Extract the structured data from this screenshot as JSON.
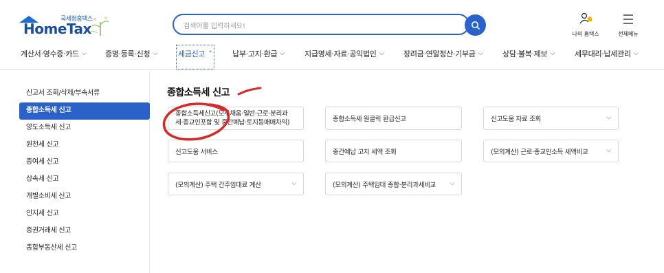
{
  "header": {
    "logo_small": "국세청홈택스",
    "logo_main": "HomeTax",
    "search_placeholder": "검색어를 입력하세요!",
    "my_hometax": "나의 홈택스",
    "all_menu": "전체메뉴"
  },
  "nav": {
    "items": [
      {
        "label": "계산서·영수증·카드"
      },
      {
        "label": "증명·등록·신청"
      },
      {
        "label": "세금신고"
      },
      {
        "label": "납부·고지·환급"
      },
      {
        "label": "지급명세·자료·공익법인"
      },
      {
        "label": "장려금·연말정산·기부금"
      },
      {
        "label": "상담·불복·제보"
      },
      {
        "label": "세무대리·납세관리"
      }
    ]
  },
  "sidebar": {
    "items": [
      {
        "label": "신고서 조회/삭제/부속서류"
      },
      {
        "label": "종합소득세 신고"
      },
      {
        "label": "양도소득세 신고"
      },
      {
        "label": "원천세 신고"
      },
      {
        "label": "증여세 신고"
      },
      {
        "label": "상속세 신고"
      },
      {
        "label": "개별소비세 신고"
      },
      {
        "label": "인지세 신고"
      },
      {
        "label": "증권거래세 신고"
      },
      {
        "label": "종합부동산세 신고"
      }
    ]
  },
  "main": {
    "title": "종합소득세 신고",
    "cards": [
      {
        "line1": "종합소득세신고(모두채움·일반·근로·분리과",
        "line2": "세·종교인포함 및 중간예납·토지등매매차익)"
      },
      {
        "label": "종합소득세 원클릭 환급신고"
      },
      {
        "label": "신고도움 자료 조회"
      },
      {
        "label": "신고도움 서비스"
      },
      {
        "label": "중간예납 고지 세액 조회"
      },
      {
        "label": "(모의계산) 근로·종교인소득 세액비교"
      },
      {
        "label": "(모의계산) 주택 간주임대료 계산"
      },
      {
        "label": "(모의계산) 주택임대 종합·분리과세비교"
      }
    ]
  },
  "colors": {
    "accent": "#2a62c9",
    "annotation": "#d42a2a"
  }
}
